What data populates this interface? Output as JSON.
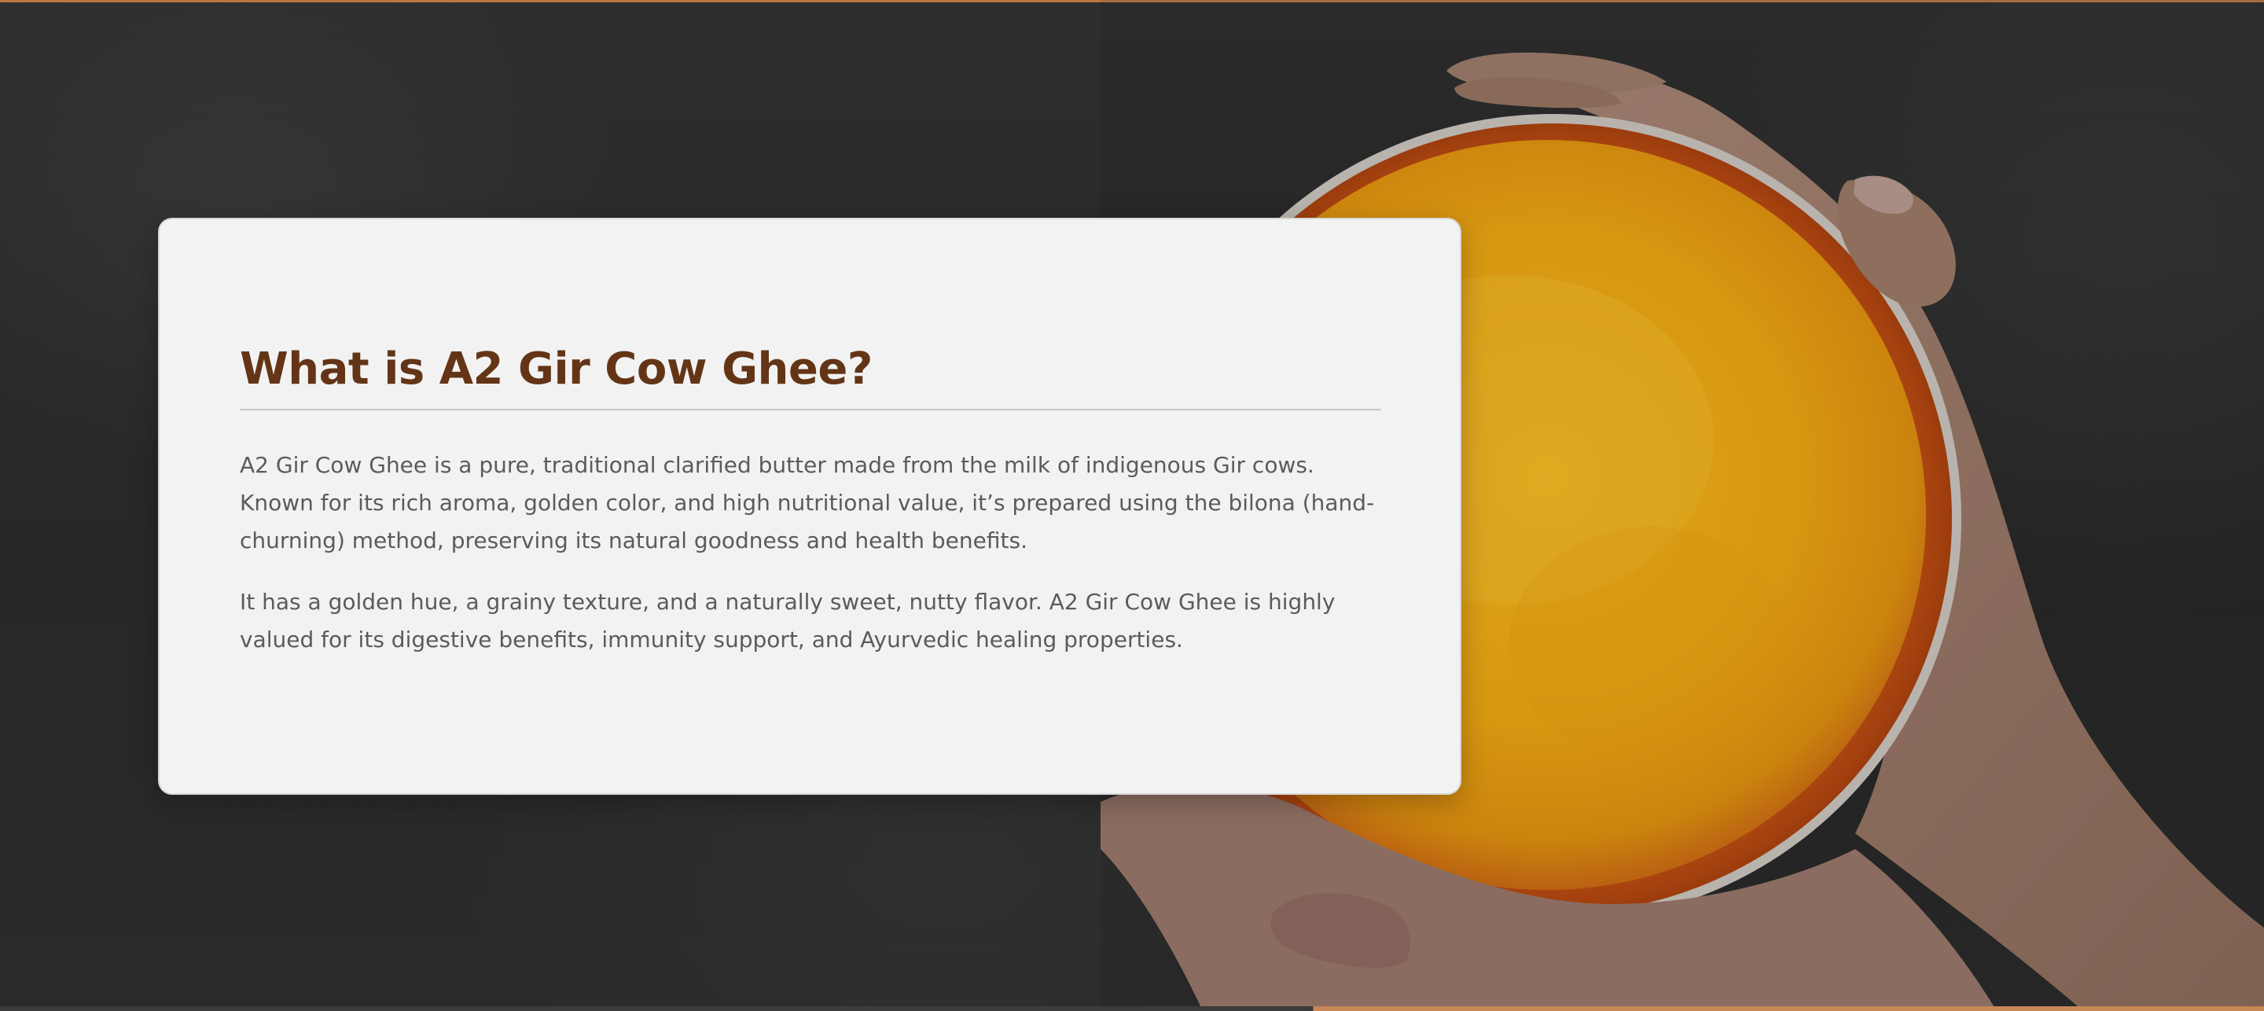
{
  "section": {
    "title": "What is A2 Gir Cow Ghee?",
    "paragraphs": [
      "A2 Gir Cow Ghee is a pure, traditional clarified butter made from the milk of indigenous Gir cows. Known for its rich aroma, golden color, and high nutritional value, it’s prepared using the bilona (hand-churning) method, preserving its natural goodness and health benefits.",
      "It has a golden hue, a grainy texture, and a naturally sweet, nutty flavor. A2 Gir Cow Ghee is highly valued for its digestive benefits, immunity support, and Ayurvedic healing properties."
    ]
  },
  "background_image": {
    "subject": "hands holding a bowl of golden ghee on a dark stone surface"
  },
  "colors": {
    "title": "#633516",
    "body_text": "#5b5b5b",
    "card_background": "#f2f2f2",
    "accent_rule": "#b97744",
    "ghee": "#e9a316"
  }
}
